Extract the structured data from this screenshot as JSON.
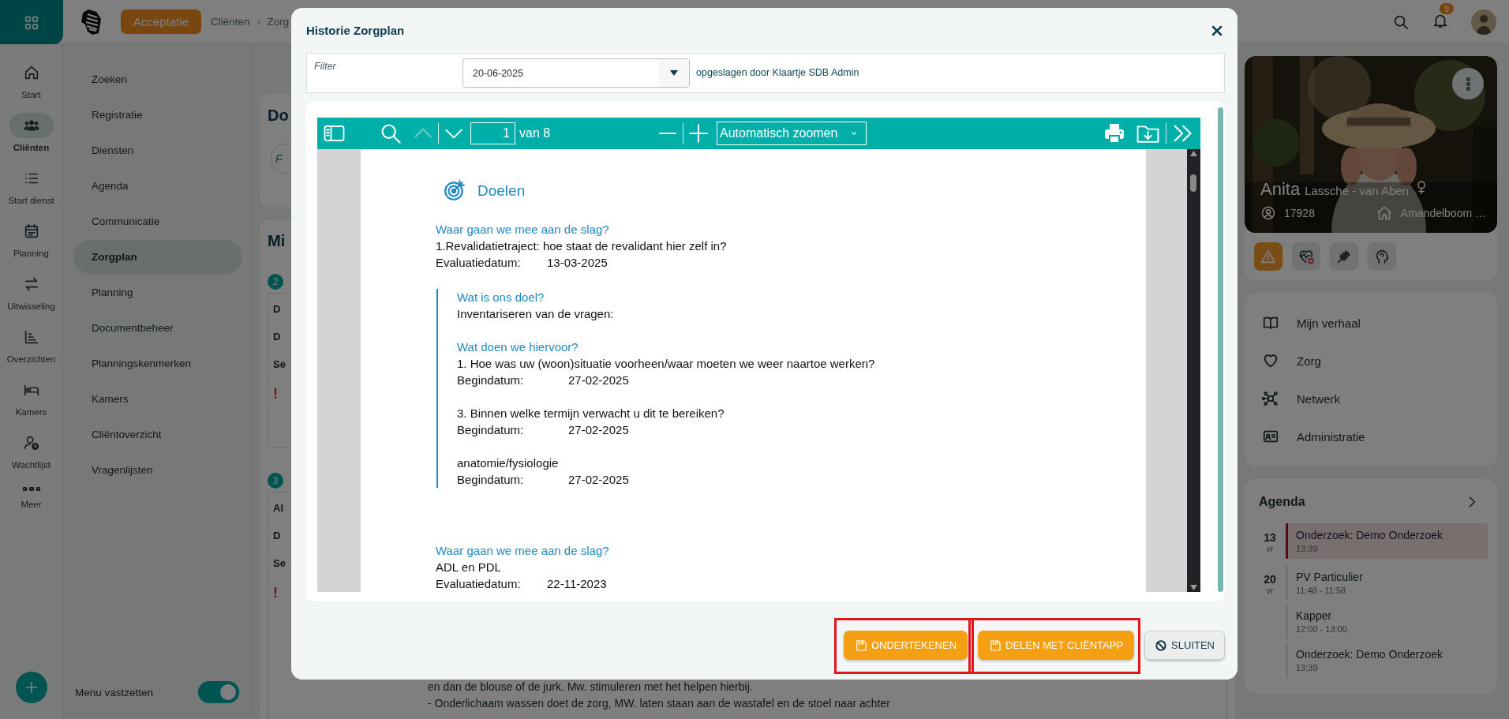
{
  "topbar": {
    "environment": "Acceptatie",
    "breadcrumb": [
      "Cliënten",
      "Zorg"
    ],
    "notifications": "9"
  },
  "rail": {
    "items": [
      {
        "label": "Start",
        "selected": false
      },
      {
        "label": "Cliënten",
        "selected": true
      },
      {
        "label": "Start dienst",
        "selected": false
      },
      {
        "label": "Planning",
        "selected": false
      },
      {
        "label": "Uitwisseling",
        "selected": false
      },
      {
        "label": "Overzichten",
        "selected": false
      },
      {
        "label": "Kamers",
        "selected": false
      },
      {
        "label": "Wachtlijst",
        "selected": false
      },
      {
        "label": "Meer",
        "selected": false
      }
    ]
  },
  "submenu": {
    "items": [
      {
        "label": "Zoeken",
        "selected": false
      },
      {
        "label": "Registratie",
        "selected": false
      },
      {
        "label": "Diensten",
        "selected": false
      },
      {
        "label": "Agenda",
        "selected": false
      },
      {
        "label": "Communicatie",
        "selected": false
      },
      {
        "label": "Zorgplan",
        "selected": true
      },
      {
        "label": "Planning",
        "selected": false
      },
      {
        "label": "Documentbeheer",
        "selected": false
      },
      {
        "label": "Planningskenmerken",
        "selected": false
      },
      {
        "label": "Kamers",
        "selected": false
      },
      {
        "label": "Cliëntoverzicht",
        "selected": false
      },
      {
        "label": "Vragenlijsten",
        "selected": false
      }
    ],
    "pin": {
      "label": "Menu vastzetten",
      "on": true
    }
  },
  "main": {
    "heading_1": "Do",
    "filter_placeholder": "F",
    "heading_2": "Mi",
    "groups": [
      {
        "count": "2",
        "lines": [
          "D",
          "D",
          "Se"
        ],
        "alert": "!"
      },
      {
        "count": "3",
        "lines": [
          "Al",
          "D",
          "Se"
        ],
        "alert": "!"
      }
    ],
    "notes": [
      "en dan de blouse of de jurk. Mw. stimuleren met het helpen hierbij.",
      "- Onderlichaam wassen doet de zorg, MW. laten staan aan de wastafel en de stoel naar achter"
    ]
  },
  "modal": {
    "title": "Historie Zorgplan",
    "filter": {
      "label": "Filter",
      "value": "20-06-2025",
      "saved_by": "opgeslagen door Klaartje SDB Admin"
    },
    "viewer": {
      "page": "1",
      "page_count": "van 8",
      "zoom": "Automatisch zoomen",
      "previous_disabled": true,
      "next_disabled": false
    },
    "document": {
      "heading": "Doelen",
      "sections": [
        {
          "question": "Waar gaan we mee aan de slag?",
          "subject": "1.Revalidatietraject: hoe staat de revalidant hier zelf in?",
          "date_label": "Evaluatiedatum:",
          "date": "13-03-2025",
          "goal_title": "Wat is ons doel?",
          "goal": "Inventariseren van de vragen:",
          "actions_title": "Wat doen we hiervoor?",
          "actions": [
            {
              "text": "1. Hoe was uw (woon)situatie voorheen/waar moeten we weer naartoe werken?",
              "date_label": "Begindatum:",
              "date": "27-02-2025"
            },
            {
              "text": "3. Binnen welke termijn verwacht u dit te bereiken?",
              "date_label": "Begindatum:",
              "date": "27-02-2025"
            },
            {
              "text": "anatomie/fysiologie",
              "date_label": "Begindatum:",
              "date": "27-02-2025"
            }
          ]
        },
        {
          "question": "Waar gaan we mee aan de slag?",
          "subject": "ADL en PDL",
          "date_label": "Evaluatiedatum:",
          "date": "22-11-2023"
        }
      ]
    },
    "buttons": [
      {
        "label": "ONDERTEKENEN",
        "kind": "primary",
        "highlighted": true
      },
      {
        "label": "DELEN MET CLIËNTAPP",
        "kind": "primary",
        "highlighted": true
      },
      {
        "label": "SLUITEN",
        "kind": "secondary",
        "highlighted": false
      }
    ]
  },
  "profile": {
    "first_name": "Anita",
    "last_name": "Lassche - van Aben",
    "client_id": "17928",
    "location": "Amandelboom …",
    "alerts": [
      {
        "active": true
      },
      {
        "active": false
      },
      {
        "active": false
      },
      {
        "active": false
      }
    ]
  },
  "client_menu": [
    {
      "label": "Mijn verhaal"
    },
    {
      "label": "Zorg"
    },
    {
      "label": "Netwerk"
    },
    {
      "label": "Administratie"
    }
  ],
  "agenda": {
    "title": "Agenda",
    "days": [
      {
        "day": "13",
        "weekday": "vr",
        "events": [
          {
            "title": "Onderzoek: Demo Onderzoek",
            "time": "13:39",
            "highlighted": true
          }
        ]
      },
      {
        "day": "20",
        "weekday": "vr",
        "events": [
          {
            "title": "PV Particulier",
            "time": "11:48 - 11:58",
            "highlighted": false
          },
          {
            "title": "Kapper",
            "time": "12:00 - 13:00",
            "highlighted": false
          },
          {
            "title": "Onderzoek: Demo Onderzoek",
            "time": "13:39",
            "highlighted": false
          }
        ]
      }
    ]
  }
}
